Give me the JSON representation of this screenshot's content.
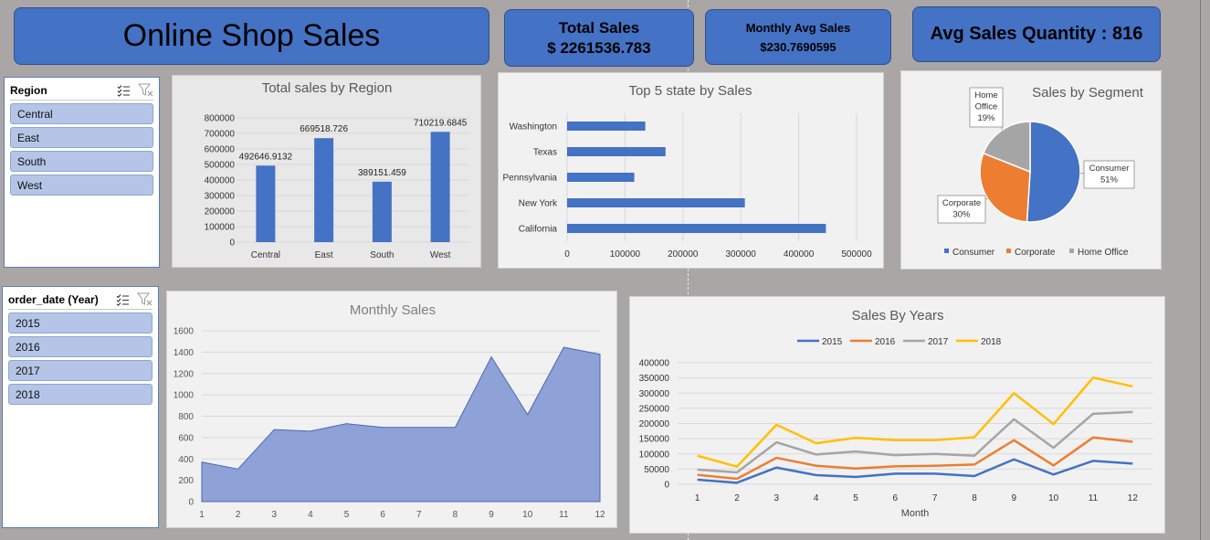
{
  "header": {
    "title": "Online Shop Sales",
    "total_sales_label": "Total Sales",
    "total_sales_value": "$ 2261536.783",
    "monthly_avg_label": "Monthly Avg Sales",
    "monthly_avg_value": "$230.7690595",
    "avg_quantity_label": "Avg Sales Quantity : 816"
  },
  "slicers": {
    "region": {
      "title": "Region",
      "items": [
        "Central",
        "East",
        "South",
        "West"
      ]
    },
    "year": {
      "title": "order_date (Year)",
      "items": [
        "2015",
        "2016",
        "2017",
        "2018"
      ]
    }
  },
  "icons": {
    "multi_select": "multi-select-icon",
    "clear_filter": "clear-filter-icon"
  },
  "colors": {
    "header_fill": "#4472c4",
    "bar": "#4472c4",
    "area": "#8ea2d8",
    "pie_consumer": "#4472c4",
    "pie_corporate": "#ed7d31",
    "pie_home_office": "#a5a5a5",
    "line_2015": "#4472c4",
    "line_2016": "#ed7d31",
    "line_2017": "#a5a5a5",
    "line_2018": "#ffc000",
    "slicer_item": "#b4c5e7"
  },
  "chart_data": [
    {
      "id": "region",
      "type": "bar",
      "title": "Total sales by Region",
      "categories": [
        "Central",
        "East",
        "South",
        "West"
      ],
      "values": [
        492646.9132,
        669518.726,
        389151.459,
        710219.6845
      ],
      "data_labels": [
        "492646.9132",
        "669518.726",
        "389151.459",
        "710219.6845"
      ],
      "yticks": [
        "0",
        "100000",
        "200000",
        "300000",
        "400000",
        "500000",
        "600000",
        "700000",
        "800000"
      ],
      "ylim": [
        0,
        800000
      ],
      "grid": true
    },
    {
      "id": "state",
      "type": "bar",
      "orientation": "horizontal",
      "title": "Top 5 state by Sales",
      "categories": [
        "Washington",
        "Texas",
        "Pennsylvania",
        "New York",
        "California"
      ],
      "values": [
        135000,
        170000,
        116000,
        307000,
        447000
      ],
      "xticks": [
        "0",
        "100000",
        "200000",
        "300000",
        "400000",
        "500000"
      ],
      "xlim": [
        0,
        500000
      ],
      "grid": true
    },
    {
      "id": "segment",
      "type": "pie",
      "title": "Sales by Segment",
      "slices": [
        {
          "name": "Consumer",
          "value": 51,
          "label": "51%"
        },
        {
          "name": "Corporate",
          "value": 30,
          "label": "30%"
        },
        {
          "name": "Home Office",
          "value": 19,
          "label": "19%"
        }
      ],
      "legend": [
        "Consumer",
        "Corporate",
        "Home Office"
      ],
      "legend_position": "bottom"
    },
    {
      "id": "monthly",
      "type": "area",
      "title": "Monthly Sales",
      "x": [
        "1",
        "2",
        "3",
        "4",
        "5",
        "6",
        "7",
        "8",
        "9",
        "10",
        "11",
        "12"
      ],
      "values": [
        370,
        305,
        675,
        660,
        730,
        695,
        695,
        695,
        1355,
        815,
        1445,
        1380
      ],
      "yticks": [
        "0",
        "200",
        "400",
        "600",
        "800",
        "1000",
        "1200",
        "1400",
        "1600"
      ],
      "ylim": [
        0,
        1600
      ],
      "grid": true
    },
    {
      "id": "years",
      "type": "line",
      "title": "Sales By Years",
      "xlabel": "Month",
      "x": [
        "1",
        "2",
        "3",
        "4",
        "5",
        "6",
        "7",
        "8",
        "9",
        "10",
        "11",
        "12"
      ],
      "series": [
        {
          "name": "2015",
          "values": [
            15000,
            5000,
            55000,
            30000,
            24000,
            35000,
            35000,
            27000,
            82000,
            32000,
            77000,
            68000
          ]
        },
        {
          "name": "2016",
          "values": [
            31000,
            18000,
            87000,
            61000,
            52000,
            59000,
            61000,
            65000,
            145000,
            62000,
            154000,
            140000
          ]
        },
        {
          "name": "2017",
          "values": [
            48000,
            39000,
            138000,
            98000,
            108000,
            96000,
            100000,
            94000,
            214000,
            120000,
            232000,
            238000
          ]
        },
        {
          "name": "2018",
          "values": [
            94000,
            58000,
            196000,
            135000,
            153000,
            145000,
            145000,
            155000,
            300000,
            198000,
            351000,
            322000
          ]
        }
      ],
      "yticks": [
        "0",
        "50000",
        "100000",
        "150000",
        "200000",
        "250000",
        "300000",
        "350000",
        "400000"
      ],
      "ylim": [
        0,
        400000
      ],
      "legend_position": "top",
      "grid": true
    }
  ]
}
